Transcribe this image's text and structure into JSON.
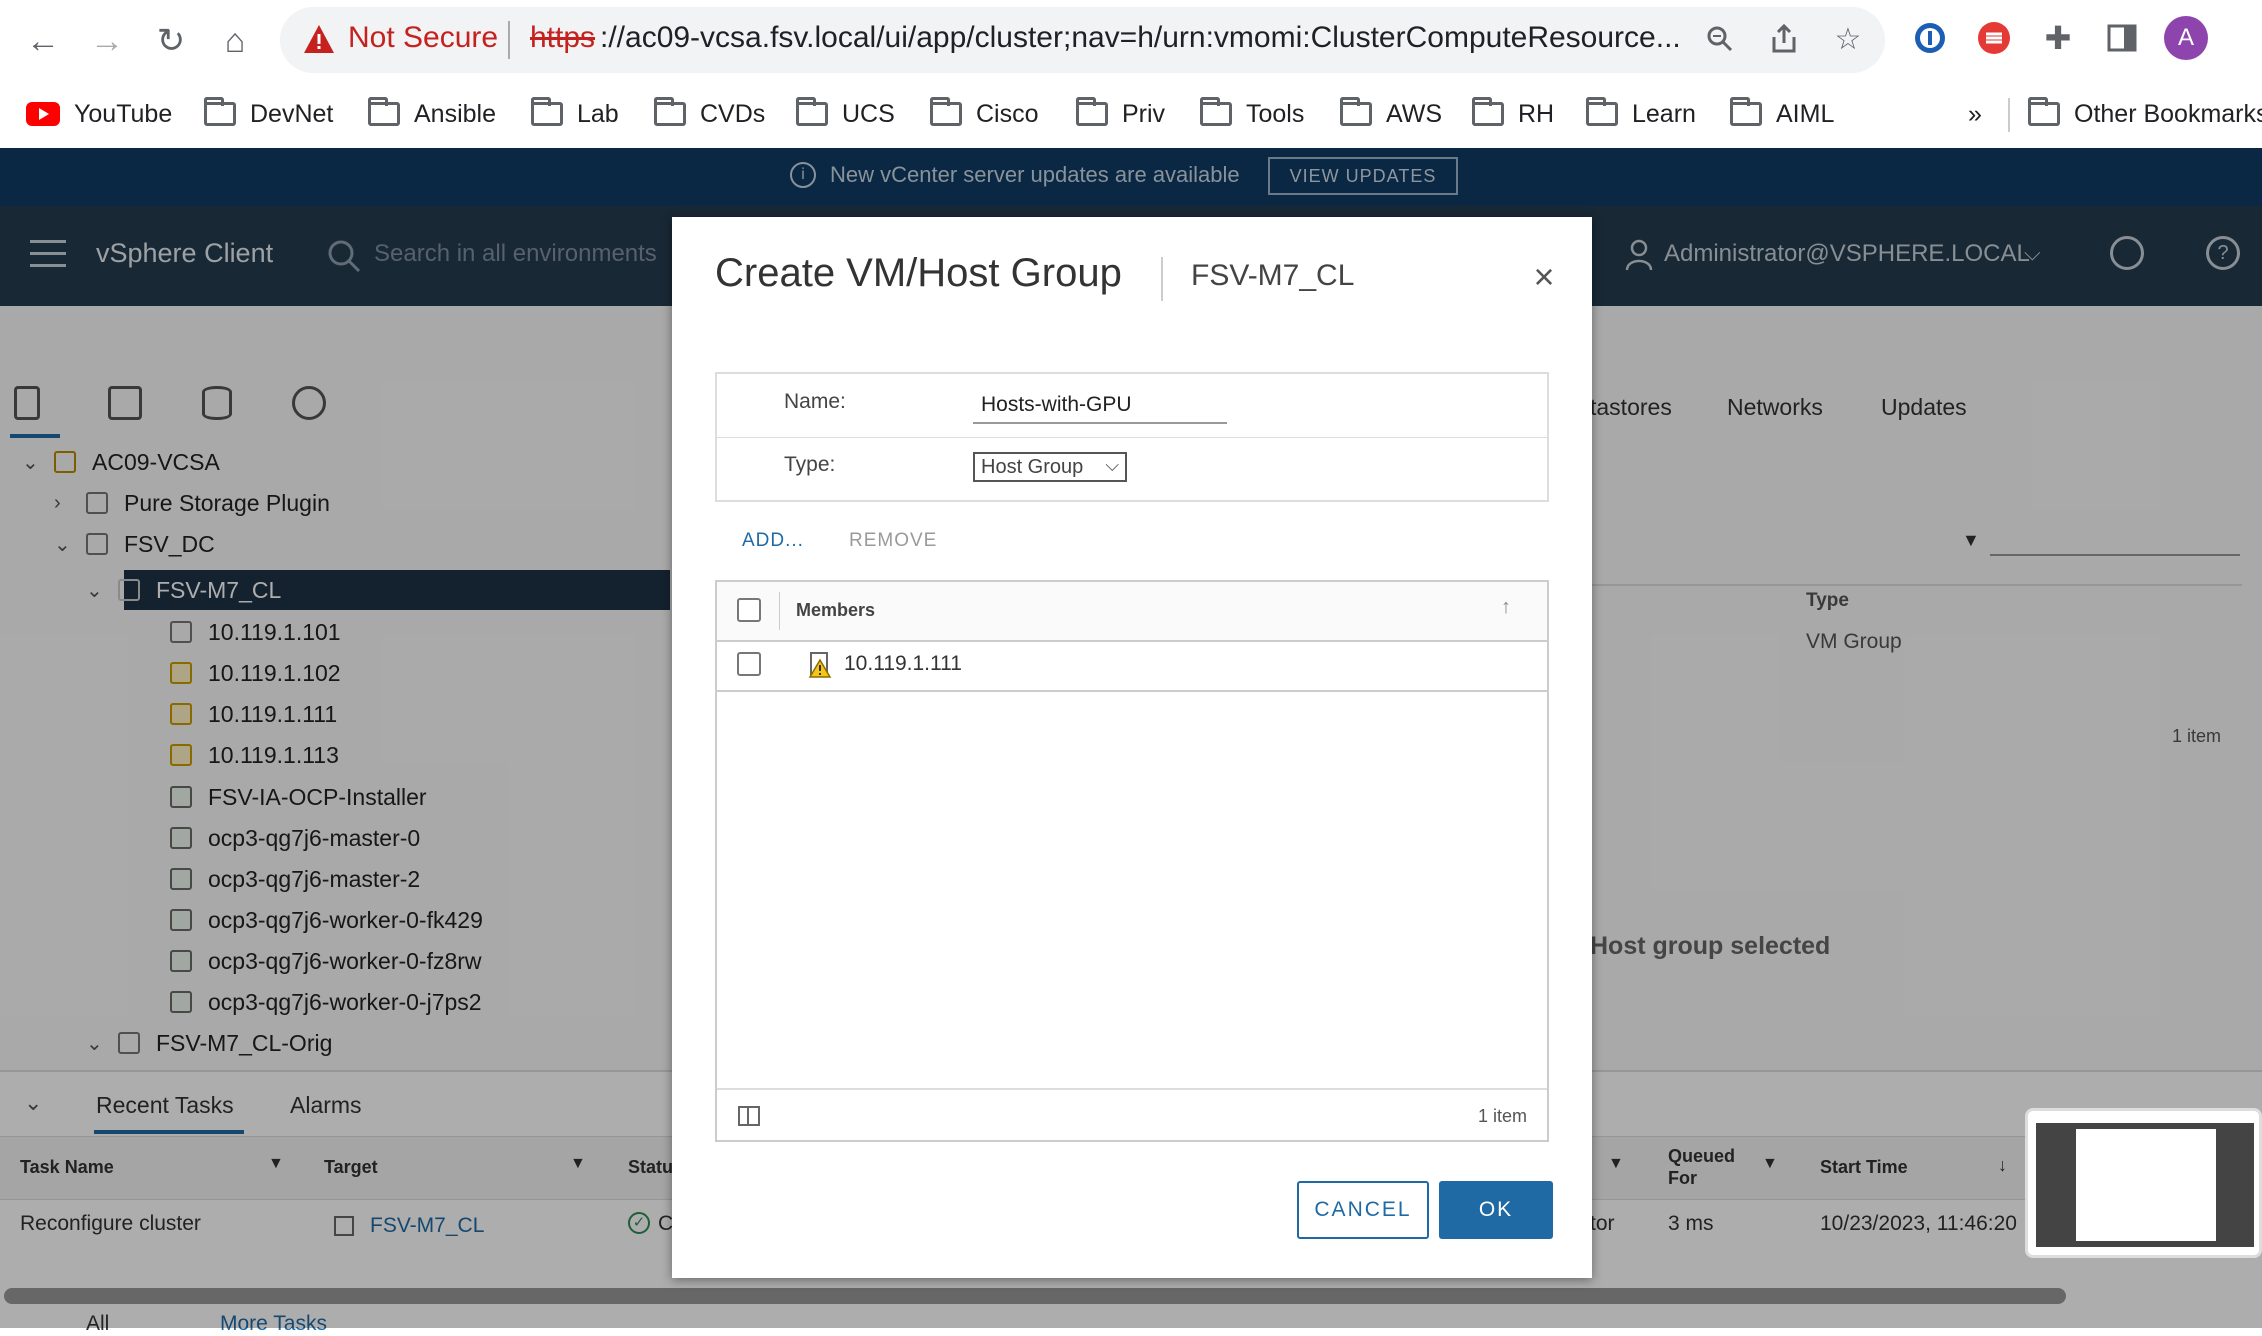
{
  "browser": {
    "not_secure": "Not Secure",
    "url_scheme": "https",
    "url_rest": "://ac09-vcsa.fsv.local/ui/app/cluster;nav=h/urn:vmomi:ClusterComputeResource...",
    "profile_initial": "A",
    "bookmarks": [
      "YouTube",
      "DevNet",
      "Ansible",
      "Lab",
      "CVDs",
      "UCS",
      "Cisco",
      "Priv",
      "Tools",
      "AWS",
      "RH",
      "Learn",
      "AIML"
    ],
    "more_bookmarks": "»",
    "other_bookmarks": "Other Bookmarks"
  },
  "vcenter": {
    "notice": "New vCenter server updates are available",
    "view_updates": "VIEW UPDATES",
    "app_name": "vSphere Client",
    "search_placeholder": "Search in all environments",
    "user": "Administrator@VSPHERE.LOCAL",
    "tabs_visible": [
      "tastores",
      "Networks",
      "Updates"
    ],
    "type_col": "Type",
    "type_value": "VM Group",
    "right_count": "1 item",
    "no_selection": "Host group selected"
  },
  "tree": [
    {
      "label": "AC09-VCSA",
      "icon": "vcenter-icon"
    },
    {
      "label": "Pure Storage Plugin",
      "icon": "folder-icon"
    },
    {
      "label": "FSV_DC",
      "icon": "datacenter-icon"
    },
    {
      "label": "FSV-M7_CL",
      "icon": "cluster-icon",
      "selected": true
    },
    {
      "label": "10.119.1.101",
      "icon": "host-icon"
    },
    {
      "label": "10.119.1.102",
      "icon": "host-warning-icon"
    },
    {
      "label": "10.119.1.111",
      "icon": "host-warning-icon"
    },
    {
      "label": "10.119.1.113",
      "icon": "host-warning-icon"
    },
    {
      "label": "FSV-IA-OCP-Installer",
      "icon": "vm-icon"
    },
    {
      "label": "ocp3-qg7j6-master-0",
      "icon": "vm-icon"
    },
    {
      "label": "ocp3-qg7j6-master-2",
      "icon": "vm-icon"
    },
    {
      "label": "ocp3-qg7j6-worker-0-fk429",
      "icon": "vm-icon"
    },
    {
      "label": "ocp3-qg7j6-worker-0-fz8rw",
      "icon": "vm-icon"
    },
    {
      "label": "ocp3-qg7j6-worker-0-j7ps2",
      "icon": "vm-icon"
    },
    {
      "label": "FSV-M7_CL-Orig",
      "icon": "cluster-icon"
    }
  ],
  "tasks": {
    "tab_recent": "Recent Tasks",
    "tab_alarms": "Alarms",
    "columns": [
      "Task Name",
      "Target",
      "Statu",
      "Queued For",
      "Start Time"
    ],
    "row": {
      "task": "Reconfigure cluster",
      "target": "FSV-M7_CL",
      "status": "C",
      "queued_partial": "tor",
      "queued": "3 ms",
      "start": "10/23/2023, 11:46:20"
    },
    "filter_all": "All",
    "more_tasks": "More Tasks"
  },
  "dialog": {
    "title": "Create VM/Host Group",
    "subtitle": "FSV-M7_CL",
    "name_label": "Name:",
    "name_value": "Hosts-with-GPU",
    "type_label": "Type:",
    "type_value": "Host Group",
    "add": "ADD...",
    "remove": "REMOVE",
    "members_header": "Members",
    "members": [
      "10.119.1.111"
    ],
    "item_count": "1 item",
    "cancel": "CANCEL",
    "ok": "OK"
  }
}
